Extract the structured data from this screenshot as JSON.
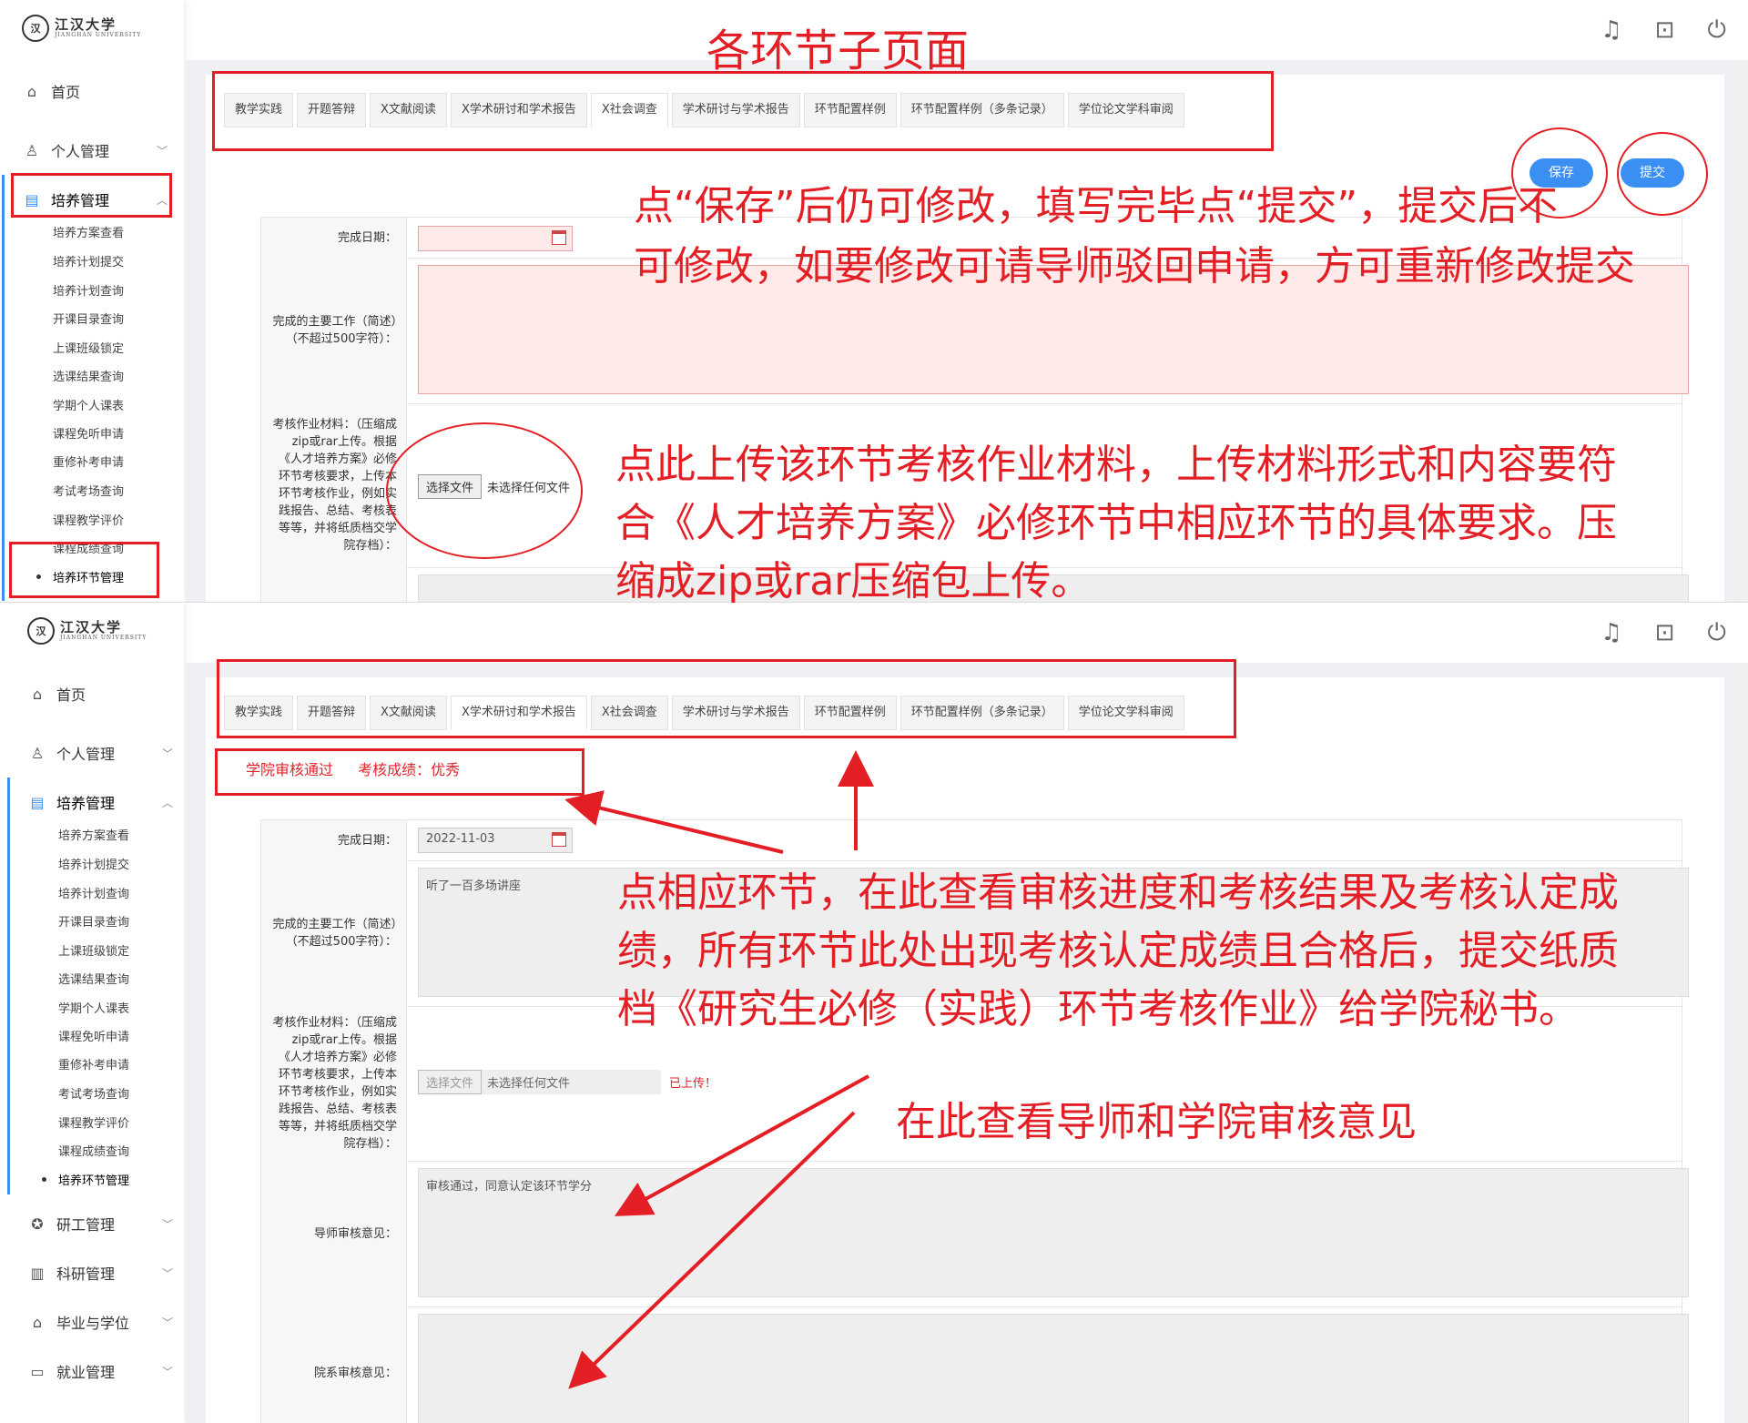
{
  "logo": {
    "cn": "江汉大学",
    "en": "JIANGHAN UNIVERSITY"
  },
  "nav": {
    "home": "首页",
    "personal": "个人管理",
    "training": "培养管理",
    "research_mgmt": "研工管理",
    "sci_research": "科研管理",
    "graduation": "毕业与学位",
    "employment": "就业管理"
  },
  "sub_items": [
    "培养方案查看",
    "培养计划提交",
    "培养计划查询",
    "开课目录查询",
    "上课班级锁定",
    "选课结果查询",
    "学期个人课表",
    "课程免听申请",
    "重修补考申请",
    "考试考场查询",
    "课程教学评价",
    "课程成绩查询",
    "培养环节管理"
  ],
  "tabs": [
    "教学实践",
    "开题答辩",
    "X文献阅读",
    "X学术研讨和学术报告",
    "X社会调查",
    "学术研讨与学术报告",
    "环节配置样例",
    "环节配置样例（多条记录）",
    "学位论文学科审阅"
  ],
  "buttons": {
    "save": "保存",
    "submit": "提交"
  },
  "form": {
    "date_label": "完成日期：",
    "work_label": "完成的主要工作（简述）（不超过500字符）：",
    "material_label": "考核作业材料：（压缩成zip或rar上传。根据《人才培养方案》必修环节考核要求，上传本环节考核作业，例如实践报告、总结、考核表等等，并将纸质档交学院存档）：",
    "file_button": "选择文件",
    "file_none": "未选择任何文件",
    "uploaded": "已上传！",
    "advisor_label": "导师审核意见：",
    "college_label": "院系审核意见："
  },
  "values": {
    "date": "2022-11-03",
    "work": "听了一百多场讲座",
    "advisor_opinion": "审核通过，同意认定该环节学分"
  },
  "status": {
    "review": "学院审核通过",
    "grade": "考核成绩：优秀"
  },
  "annotations": {
    "title": "各环节子页面",
    "save_note_1": "点“保存”后仍可修改，填写完毕点“提交”，提交后不",
    "save_note_2": "可修改，如要修改可请导师驳回申请，方可重新修改提交",
    "upload_note_1": "点此上传该环节考核作业材料，上传材料形式和内容要符",
    "upload_note_2": "合《人才培养方案》必修环节中相应环节的具体要求。压",
    "upload_note_3": "缩成zip或rar压缩包上传。",
    "check_note_1": "点相应环节，在此查看审核进度和考核结果及考核认定成",
    "check_note_2": "绩，所有环节此处出现考核认定成绩且合格后，提交纸质",
    "check_note_3": "档《研究生必修（实践）环节考核作业》给学院秘书。",
    "opinion_note": "在此查看导师和学院审核意见"
  },
  "colors": {
    "accent": "#3b8ff3",
    "annotation": "#e31e24"
  }
}
